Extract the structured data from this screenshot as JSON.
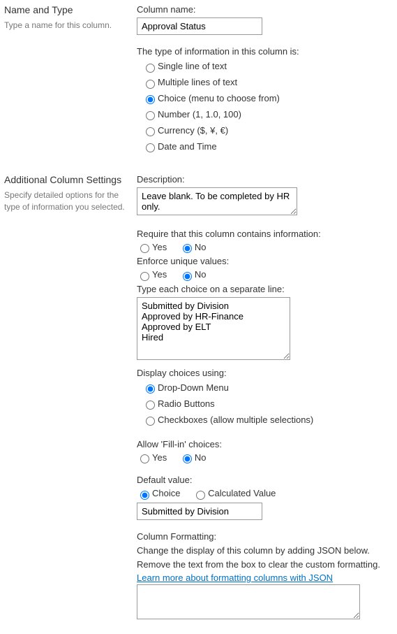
{
  "section_name": {
    "title": "Name and Type",
    "desc": "Type a name for this column.",
    "column_name_label": "Column name:",
    "column_name_value": "Approval Status",
    "type_intro": "The type of information in this column is:",
    "types": [
      "Single line of text",
      "Multiple lines of text",
      "Choice (menu to choose from)",
      "Number (1, 1.0, 100)",
      "Currency ($, ¥, €)",
      "Date and Time"
    ],
    "type_selected": 2
  },
  "section_additional": {
    "title": "Additional Column Settings",
    "desc": "Specify detailed options for the type of information you selected.",
    "description_label": "Description:",
    "description_value": "Leave blank. To be completed by HR only.",
    "require_label": "Require that this column contains information:",
    "require_value": "No",
    "enforce_label": "Enforce unique values:",
    "enforce_value": "No",
    "yes": "Yes",
    "no": "No",
    "choices_label": "Type each choice on a separate line:",
    "choices_value": "Submitted by Division\nApproved by HR-Finance\nApproved by ELT\nHired",
    "display_label": "Display choices using:",
    "display_options": [
      "Drop-Down Menu",
      "Radio Buttons",
      "Checkboxes (allow multiple selections)"
    ],
    "display_selected": 0,
    "fillin_label": "Allow 'Fill-in' choices:",
    "fillin_value": "No",
    "default_label": "Default value:",
    "default_options": [
      "Choice",
      "Calculated Value"
    ],
    "default_selected": 0,
    "default_text": "Submitted by Division",
    "format_label": "Column Formatting:",
    "format_text1": "Change the display of this column by adding JSON below.",
    "format_text2": "Remove the text from the box to clear the custom formatting.",
    "format_link": "Learn more about formatting columns with JSON",
    "format_value": ""
  }
}
